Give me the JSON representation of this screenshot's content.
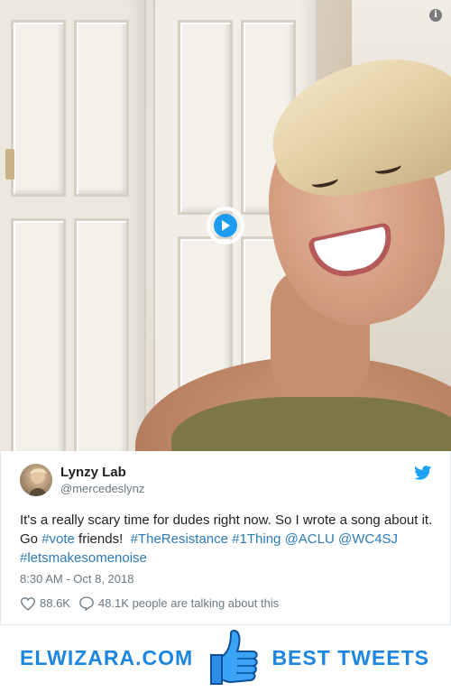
{
  "media": {
    "play_icon": "play-icon",
    "info_icon": "info-icon",
    "info_glyph": "i"
  },
  "tweet": {
    "author": {
      "display_name": "Lynzy Lab",
      "handle": "@mercedeslynz"
    },
    "text_parts": [
      {
        "text": "It's a really scary time for dudes right now. So I wrote a song about it. Go ",
        "link": false
      },
      {
        "text": "#vote",
        "link": true
      },
      {
        "text": " friends!  ",
        "link": false
      },
      {
        "text": "#TheResistance",
        "link": true
      },
      {
        "text": " ",
        "link": false
      },
      {
        "text": "#1Thing",
        "link": true
      },
      {
        "text": " ",
        "link": false
      },
      {
        "text": "@ACLU",
        "link": true
      },
      {
        "text": " ",
        "link": false
      },
      {
        "text": "@WC4SJ",
        "link": true
      },
      {
        "text": " ",
        "link": false
      },
      {
        "text": "#letsmakesomenoise",
        "link": true
      }
    ],
    "timestamp": "8:30 AM - Oct 8, 2018",
    "likes": "88.6K",
    "replies_text": "48.1K people are talking about this",
    "colors": {
      "link": "#2b7bb9",
      "muted": "#697882",
      "twitter_blue": "#1da1f2"
    }
  },
  "footer": {
    "site_name": "ELWIZARA.COM",
    "tagline": "BEST TWEETS",
    "accent": "#1d86e0"
  }
}
